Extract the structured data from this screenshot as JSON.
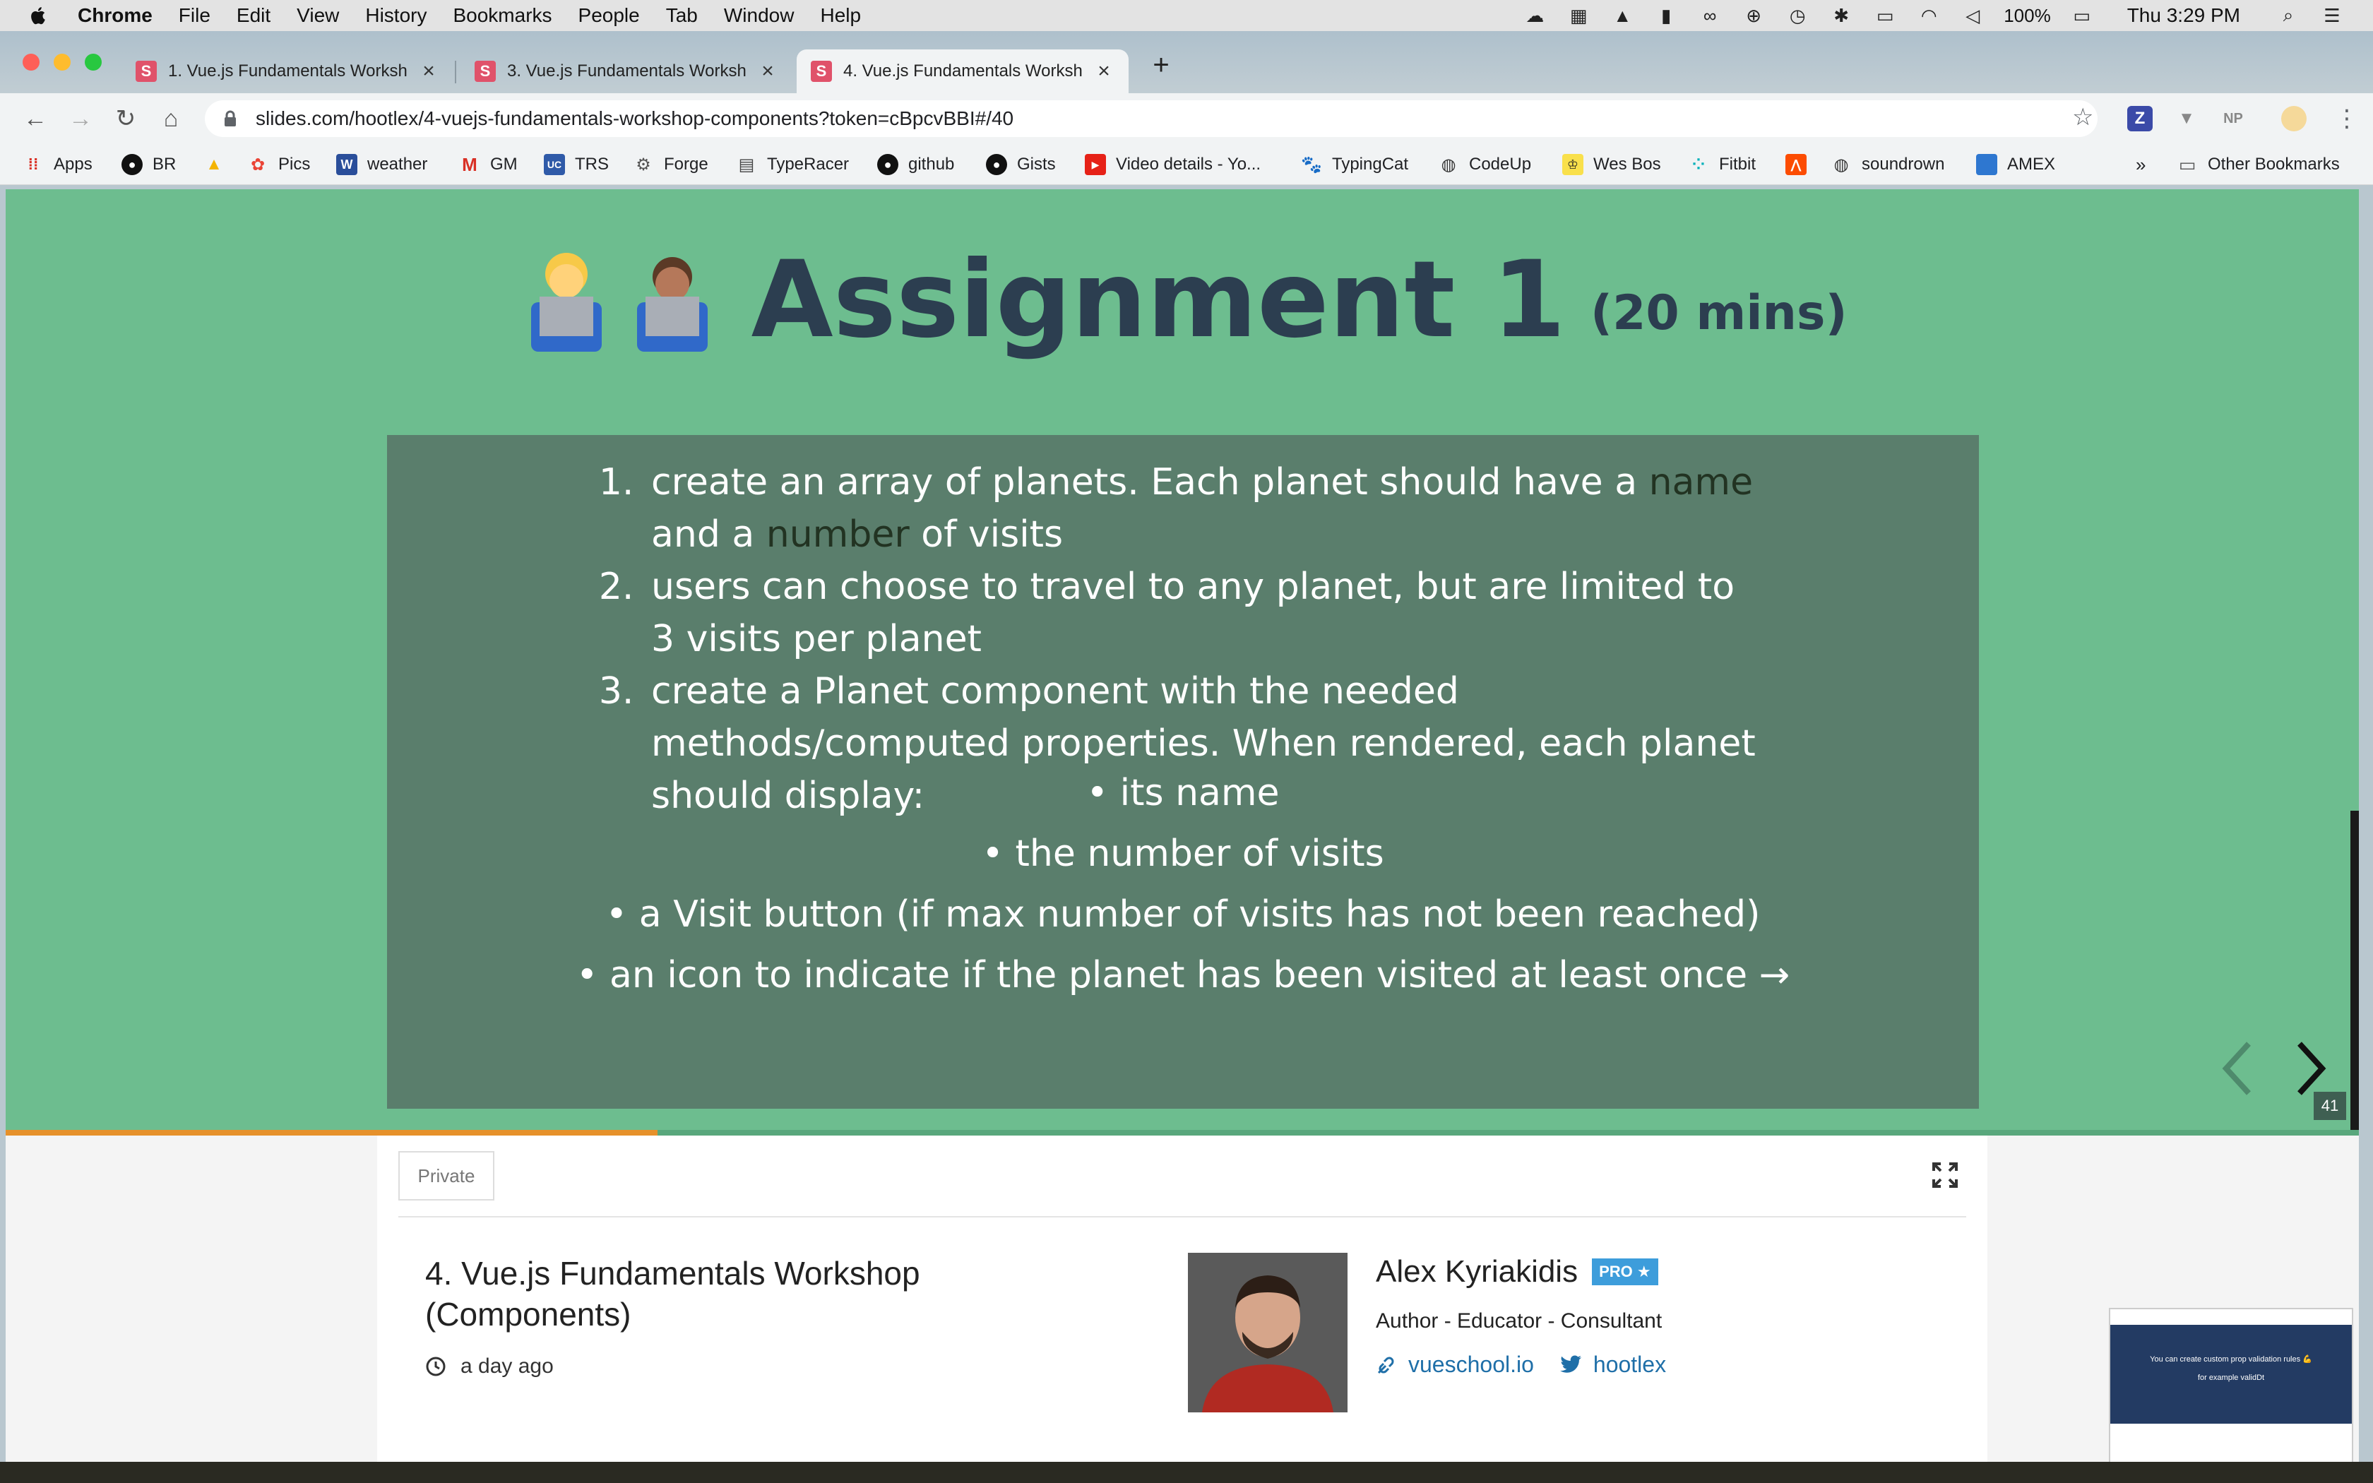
{
  "menubar": {
    "app": "Chrome",
    "items": [
      "File",
      "Edit",
      "View",
      "History",
      "Bookmarks",
      "People",
      "Tab",
      "Window",
      "Help"
    ],
    "battery": "100%",
    "clock": "Thu 3:29 PM"
  },
  "tabs": [
    {
      "favicon": "S",
      "title": "1. Vue.js Fundamentals Worksh",
      "close": "×"
    },
    {
      "favicon": "S",
      "title": "3. Vue.js Fundamentals Worksh",
      "close": "×"
    },
    {
      "favicon": "S",
      "title": "4. Vue.js Fundamentals Worksh",
      "close": "×"
    }
  ],
  "new_tab": "+",
  "toolbar": {
    "url": "slides.com/hootlex/4-vuejs-fundamentals-workshop-components?token=cBpcvBBI#/40",
    "star": "☆",
    "ext_z": "Z",
    "ext_np": "NP"
  },
  "bookmarks": {
    "items": [
      "Apps",
      "BR",
      "Pics",
      "weather",
      "GM",
      "TRS",
      "Forge",
      "TypeRacer",
      "github",
      "Gists",
      "Video details - Yo...",
      "TypingCat",
      "CodeUp",
      "Wes Bos",
      "Fitbit",
      "soundrown",
      "AMEX"
    ],
    "overflow": "»",
    "other": "Other Bookmarks"
  },
  "slide": {
    "emojis": "👩‍💻👨🏽‍💻",
    "title": "Assignment 1",
    "duration": "(20 mins)",
    "steps": [
      {
        "pre": "create an array of planets. Each planet should have a ",
        "code1": "name",
        "mid": " and a ",
        "code2": "number",
        "post": " of visits"
      },
      {
        "text": "users can choose to travel to any planet, but are limited to 3 visits per planet"
      },
      {
        "text": "create a Planet component with the needed methods/computed properties. When rendered, each planet should display:"
      }
    ],
    "sub_items": [
      "• its name",
      "• the number of visits",
      "• a Visit button (if max number of visits has not been reached)",
      "• an icon to indicate if the planet has been visited at least once →"
    ],
    "slide_number": "41",
    "progress": 0.277
  },
  "card": {
    "privacy": "Private",
    "deck_title": "4. Vue.js Fundamentals Workshop (Components)",
    "time": "a day ago",
    "author": "Alex Kyriakidis",
    "badge": "PRO ★",
    "role": "Author - Educator - Consultant",
    "website": "vueschool.io",
    "twitter": "hootlex"
  },
  "thumbnail": {
    "line1": "You can create custom prop validation rules 💪",
    "line2": "for example validDt"
  },
  "colors": {
    "slide_bg": "#6dbd8f",
    "content_box": "#5a7e6c",
    "title_text": "#2c3e50",
    "progress": "#e6912b",
    "link": "#1f6fa8",
    "badge": "#3d9ddb"
  }
}
